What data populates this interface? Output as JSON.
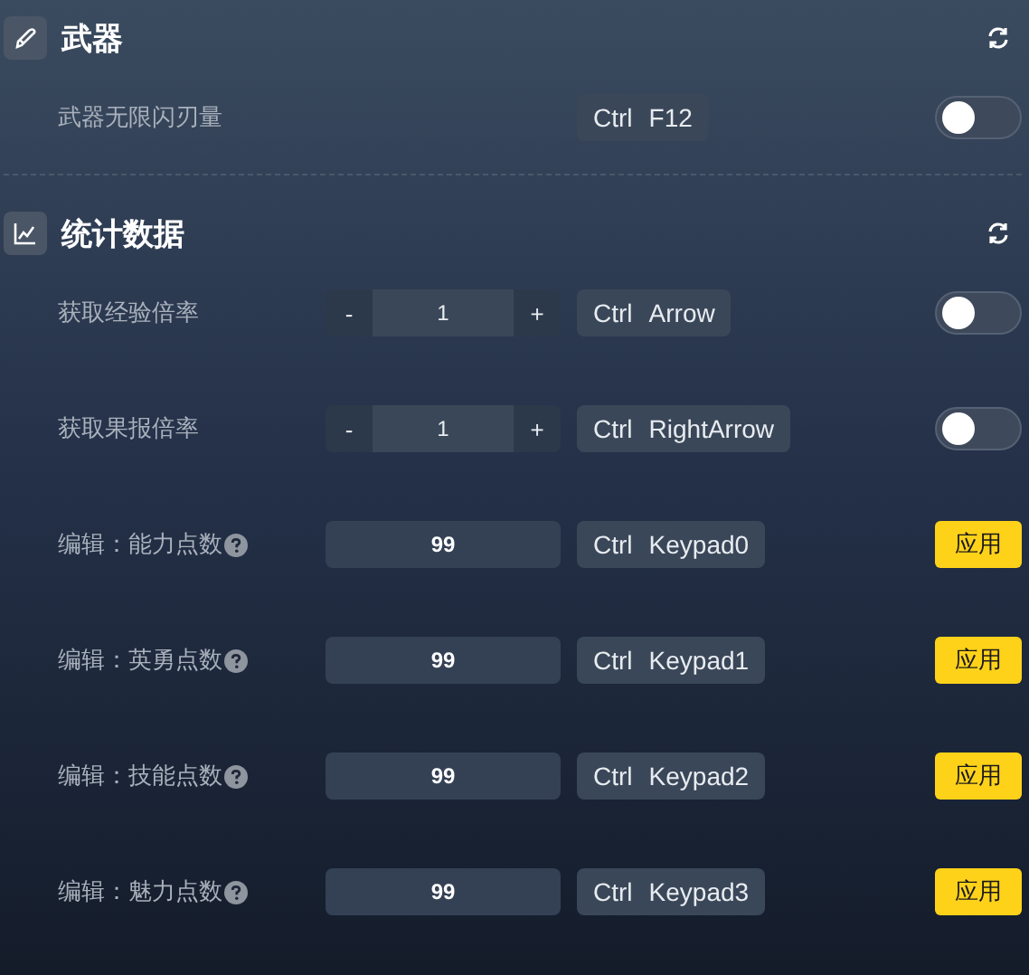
{
  "sections": [
    {
      "title": "武器",
      "rows": [
        {
          "kind": "toggle",
          "label": "武器无限闪刃量",
          "help": false,
          "keys": [
            "Ctrl",
            "F12"
          ],
          "on": false
        }
      ]
    },
    {
      "title": "统计数据",
      "rows": [
        {
          "kind": "stepper",
          "label": "获取经验倍率",
          "help": false,
          "minus": "-",
          "value": "1",
          "plus": "+",
          "keys": [
            "Ctrl",
            "Arrow"
          ],
          "on": false
        },
        {
          "kind": "stepper",
          "label": "获取果报倍率",
          "help": false,
          "minus": "-",
          "value": "1",
          "plus": "+",
          "keys": [
            "Ctrl",
            "RightArrow"
          ],
          "on": false
        },
        {
          "kind": "edit",
          "label": "编辑：能力点数",
          "help": true,
          "value": "99",
          "keys": [
            "Ctrl",
            "Keypad0"
          ],
          "button": "应用"
        },
        {
          "kind": "edit",
          "label": "编辑：英勇点数",
          "help": true,
          "value": "99",
          "keys": [
            "Ctrl",
            "Keypad1"
          ],
          "button": "应用"
        },
        {
          "kind": "edit",
          "label": "编辑：技能点数",
          "help": true,
          "value": "99",
          "keys": [
            "Ctrl",
            "Keypad2"
          ],
          "button": "应用"
        },
        {
          "kind": "edit",
          "label": "编辑：魅力点数",
          "help": true,
          "value": "99",
          "keys": [
            "Ctrl",
            "Keypad3"
          ],
          "button": "应用"
        }
      ]
    }
  ]
}
